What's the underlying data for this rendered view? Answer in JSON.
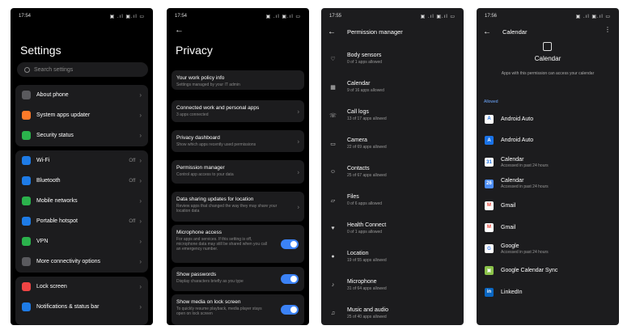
{
  "phone1": {
    "status_time": "17:54",
    "status_icons": "▣ .ıl ▣.ıl ▭",
    "title": "Settings",
    "search_placeholder": "Search settings",
    "group1": [
      {
        "label": "About phone",
        "icon": "phone-icon",
        "color": "#5a5a5e"
      },
      {
        "label": "System apps updater",
        "icon": "arrow-up-icon",
        "color": "#ff7a29"
      },
      {
        "label": "Security status",
        "icon": "shield-icon",
        "color": "#2bb24c"
      }
    ],
    "group2": [
      {
        "label": "Wi-Fi",
        "meta": "Off",
        "icon": "wifi-icon",
        "color": "#1e7be6"
      },
      {
        "label": "Bluetooth",
        "meta": "Off",
        "icon": "bluetooth-icon",
        "color": "#1e7be6"
      },
      {
        "label": "Mobile networks",
        "meta": "",
        "icon": "signal-icon",
        "color": "#2bb24c"
      },
      {
        "label": "Portable hotspot",
        "meta": "Off",
        "icon": "hotspot-icon",
        "color": "#1e7be6"
      },
      {
        "label": "VPN",
        "meta": "",
        "icon": "vpn-icon",
        "color": "#2bb24c"
      },
      {
        "label": "More connectivity options",
        "meta": "",
        "icon": "connectivity-icon",
        "color": "#5a5a5e"
      }
    ],
    "group3": [
      {
        "label": "Lock screen",
        "icon": "lock-icon",
        "color": "#ef4444"
      },
      {
        "label": "Notifications & status bar",
        "icon": "notification-icon",
        "color": "#1e7be6"
      }
    ]
  },
  "phone2": {
    "status_time": "17:54",
    "status_icons": "▣ .ıl ▣.ıl ▭",
    "back": "←",
    "title": "Privacy",
    "cards": [
      {
        "h": "Your work policy info",
        "s": "Settings managed by your IT admin",
        "type": "plain"
      },
      {
        "h": "Connected work and personal apps",
        "s": "3 apps connected",
        "type": "chev"
      },
      {
        "h": "Privacy dashboard",
        "s": "Show which apps recently used permissions",
        "type": "chev"
      },
      {
        "h": "Permission manager",
        "s": "Control app access to your data",
        "type": "chev"
      },
      {
        "h": "Data sharing updates for location",
        "s": "Review apps that changed the way they may share your location data",
        "type": "chev"
      },
      {
        "h": "Microphone access",
        "s": "For apps and services. If this setting is off, microphone data may still be shared when you call an emergency number.",
        "type": "toggle"
      },
      {
        "h": "Show passwords",
        "s": "Display characters briefly as you type",
        "type": "toggle"
      },
      {
        "h": "Show media on lock screen",
        "s": "To quickly resume playback, media player stays open on lock screen",
        "type": "toggle"
      }
    ]
  },
  "phone3": {
    "status_time": "17:55",
    "status_icons": "▣ .ıl ▣.ıl ▭",
    "title": "Permission manager",
    "items": [
      {
        "h": "Body sensors",
        "s": "0 of 1 apps allowed",
        "icon": "heart-icon",
        "glyph": "♡"
      },
      {
        "h": "Calendar",
        "s": "9 of 16 apps allowed",
        "icon": "calendar-icon",
        "glyph": "▦"
      },
      {
        "h": "Call logs",
        "s": "13 of 17 apps allowed",
        "icon": "call-log-icon",
        "glyph": "☏"
      },
      {
        "h": "Camera",
        "s": "22 of 69 apps allowed",
        "icon": "camera-icon",
        "glyph": "▭"
      },
      {
        "h": "Contacts",
        "s": "25 of 67 apps allowed",
        "icon": "contacts-icon",
        "glyph": "☺"
      },
      {
        "h": "Files",
        "s": "0 of 6 apps allowed",
        "icon": "folder-icon",
        "glyph": "▱"
      },
      {
        "h": "Health Connect",
        "s": "0 of 1 apps allowed",
        "icon": "health-icon",
        "glyph": "♥"
      },
      {
        "h": "Location",
        "s": "19 of 55 apps allowed",
        "icon": "location-icon",
        "glyph": "●"
      },
      {
        "h": "Microphone",
        "s": "31 of 64 apps allowed",
        "icon": "microphone-icon",
        "glyph": "♪"
      },
      {
        "h": "Music and audio",
        "s": "25 of 40 apps allowed",
        "icon": "music-icon",
        "glyph": "♫"
      }
    ]
  },
  "phone4": {
    "status_time": "17:56",
    "status_icons": "▣ .ıl ▣.ıl ▭",
    "title": "Calendar",
    "menu": "⋮",
    "heading": "Calendar",
    "description": "Apps with this permission can access your calendar",
    "allowed_label": "Allowed",
    "apps": [
      {
        "h": "Android Auto",
        "s": "",
        "icon": "android-auto-icon",
        "glyph": "A",
        "bg": "#ffffff",
        "fg": "#1a73e8"
      },
      {
        "h": "Android Auto",
        "s": "",
        "icon": "android-auto-icon",
        "glyph": "A",
        "bg": "#1a73e8",
        "fg": "#ffffff"
      },
      {
        "h": "Calendar",
        "s": "Accessed in past 24 hours",
        "icon": "google-calendar-icon",
        "glyph": "31",
        "bg": "#ffffff",
        "fg": "#1a73e8"
      },
      {
        "h": "Calendar",
        "s": "Accessed in past 24 hours",
        "icon": "calendar-app-icon",
        "glyph": "26",
        "bg": "#4d8ef7",
        "fg": "#ffffff"
      },
      {
        "h": "Gmail",
        "s": "",
        "icon": "gmail-icon",
        "glyph": "M",
        "bg": "#ffffff",
        "fg": "#ea4335"
      },
      {
        "h": "Gmail",
        "s": "",
        "icon": "gmail-icon",
        "glyph": "M",
        "bg": "#ffffff",
        "fg": "#ea4335"
      },
      {
        "h": "Google",
        "s": "Accessed in past 24 hours",
        "icon": "google-icon",
        "glyph": "G",
        "bg": "#ffffff",
        "fg": "#4285f4"
      },
      {
        "h": "Google Calendar Sync",
        "s": "",
        "icon": "calendar-sync-icon",
        "glyph": "▣",
        "bg": "#8bc34a",
        "fg": "#ffffff"
      },
      {
        "h": "LinkedIn",
        "s": "",
        "icon": "linkedin-icon",
        "glyph": "in",
        "bg": "#0a66c2",
        "fg": "#ffffff"
      }
    ]
  }
}
